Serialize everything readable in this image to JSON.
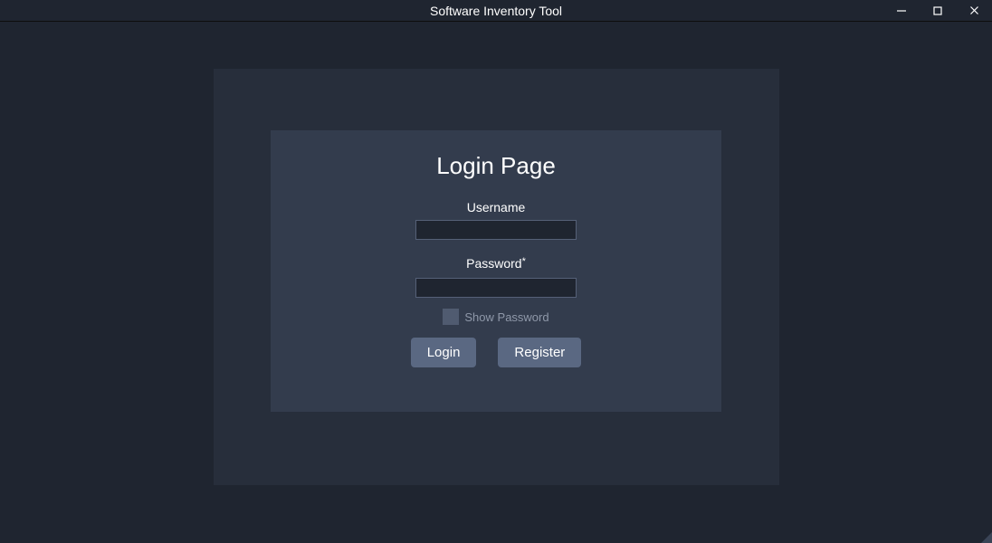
{
  "window": {
    "title": "Software Inventory Tool"
  },
  "login": {
    "heading": "Login Page",
    "username_label": "Username",
    "username_value": "",
    "password_label": "Password",
    "password_asterisk": "*",
    "password_value": "",
    "show_password_label": "Show Password",
    "show_password_checked": false,
    "login_button": "Login",
    "register_button": "Register"
  }
}
